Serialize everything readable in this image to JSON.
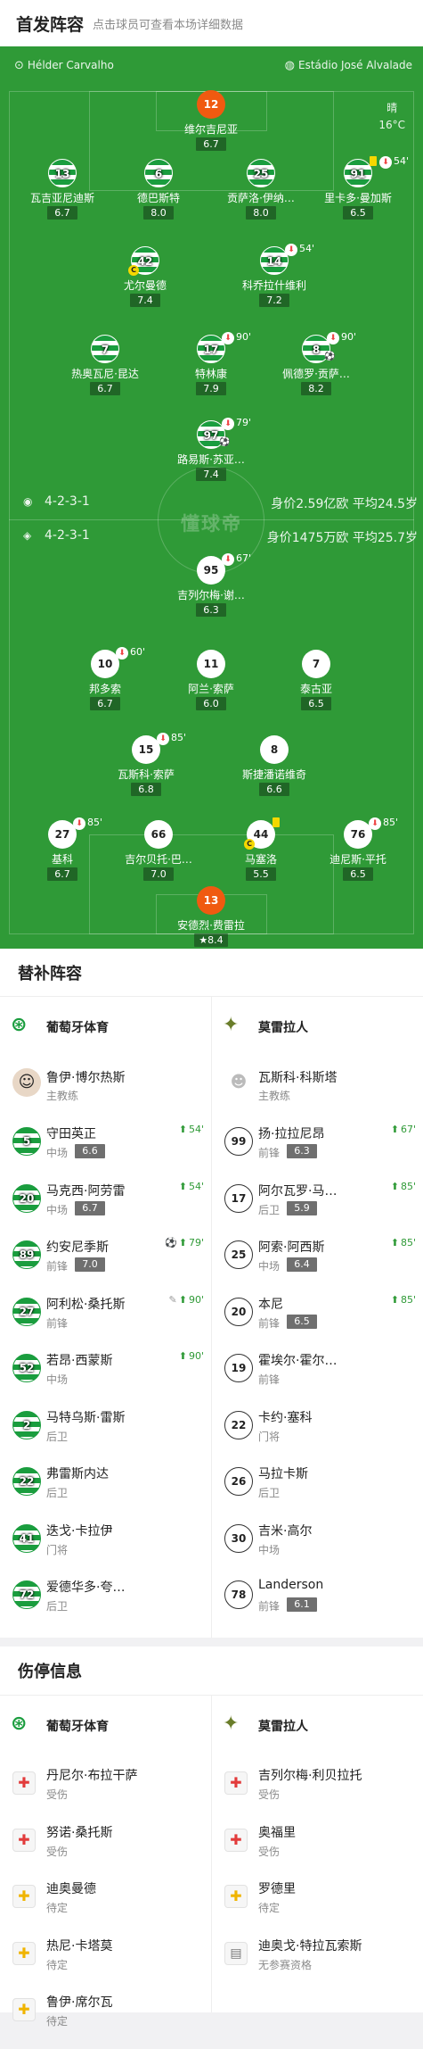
{
  "header": {
    "title": "首发阵容",
    "subtitle": "点击球员可查看本场详细数据"
  },
  "pitch": {
    "referee": "Hélder Carvalho",
    "stadium": "Estádio José Alvalade",
    "weather": "晴",
    "temperature": "16°C",
    "watermark": "懂球帝",
    "home_info": {
      "formation": "4-2-3-1",
      "value_label": "身价2.59亿欧",
      "age_label": "平均24.5岁"
    },
    "away_info": {
      "formation": "4-2-3-1",
      "value_label": "身价1475万欧",
      "age_label": "平均25.7岁"
    }
  },
  "lineup_home": [
    {
      "number": "12",
      "name": "维尔吉尼亚",
      "rating": "6.7",
      "gk": true
    },
    {
      "number": "13",
      "name": "瓦吉亚尼迪斯",
      "rating": "6.7"
    },
    {
      "number": "6",
      "name": "德巴斯特",
      "rating": "8.0"
    },
    {
      "number": "25",
      "name": "贡萨洛·伊纳…",
      "rating": "8.0"
    },
    {
      "number": "91",
      "name": "里卡多·曼加斯",
      "rating": "6.5",
      "card": true,
      "sub_out": "54'"
    },
    {
      "number": "42",
      "name": "尤尔曼德",
      "rating": "7.4",
      "captain": "C"
    },
    {
      "number": "14",
      "name": "科乔拉什维利",
      "rating": "7.2",
      "sub_out": "54'"
    },
    {
      "number": "7",
      "name": "热奥瓦尼·昆达",
      "rating": "6.7"
    },
    {
      "number": "17",
      "name": "特林康",
      "rating": "7.9",
      "sub_out": "90'"
    },
    {
      "number": "8",
      "name": "佩德罗·贡萨…",
      "rating": "8.2",
      "sub_out": "90'",
      "goal": true
    },
    {
      "number": "97",
      "name": "路易斯·苏亚…",
      "rating": "7.4",
      "sub_out": "79'",
      "goal": true
    }
  ],
  "lineup_away": [
    {
      "number": "95",
      "name": "吉列尔梅·谢…",
      "rating": "6.3",
      "sub_out": "67'"
    },
    {
      "number": "10",
      "name": "邦多索",
      "rating": "6.7",
      "sub_out": "60'"
    },
    {
      "number": "11",
      "name": "阿兰·索萨",
      "rating": "6.0"
    },
    {
      "number": "7",
      "name": "泰古亚",
      "rating": "6.5"
    },
    {
      "number": "15",
      "name": "瓦斯科·索萨",
      "rating": "6.8",
      "sub_out": "85'"
    },
    {
      "number": "8",
      "name": "斯捷潘诺维奇",
      "rating": "6.6"
    },
    {
      "number": "27",
      "name": "基科",
      "rating": "6.7",
      "sub_out": "85'"
    },
    {
      "number": "66",
      "name": "吉尔贝托·巴…",
      "rating": "7.0"
    },
    {
      "number": "44",
      "name": "马塞洛",
      "rating": "5.5",
      "card": true,
      "captain": "C"
    },
    {
      "number": "76",
      "name": "迪尼斯·平托",
      "rating": "6.5",
      "sub_out": "85'"
    },
    {
      "number": "13",
      "name": "安德烈·费雷拉",
      "rating": "8.4",
      "gk": true,
      "star": true
    }
  ],
  "subs": {
    "title": "替补阵容",
    "home_team": "葡萄牙体育",
    "away_team": "莫雷拉人",
    "home_coach": {
      "name": "鲁伊·博尔热斯",
      "role": "主教练"
    },
    "away_coach": {
      "name": "瓦斯科·科斯塔",
      "role": "主教练"
    },
    "home": [
      {
        "number": "5",
        "name": "守田英正",
        "pos": "中场",
        "rating": "6.6",
        "event": "54'"
      },
      {
        "number": "20",
        "name": "马克西·阿劳雷",
        "pos": "中场",
        "rating": "6.7",
        "event": "54'"
      },
      {
        "number": "89",
        "name": "约安尼季斯",
        "pos": "前锋",
        "rating": "7.0",
        "event": "79'",
        "goal": true
      },
      {
        "number": "27",
        "name": "阿利松·桑托斯",
        "pos": "前锋",
        "rating": "",
        "event": "90'",
        "boot": true
      },
      {
        "number": "52",
        "name": "若昂·西蒙斯",
        "pos": "中场",
        "rating": "",
        "event": "90'"
      },
      {
        "number": "2",
        "name": "马特乌斯·雷斯",
        "pos": "后卫",
        "rating": "",
        "event": ""
      },
      {
        "number": "22",
        "name": "弗雷斯内达",
        "pos": "后卫",
        "rating": "",
        "event": ""
      },
      {
        "number": "41",
        "name": "迭戈·卡拉伊",
        "pos": "门将",
        "rating": "",
        "event": ""
      },
      {
        "number": "72",
        "name": "爱德华多·夸…",
        "pos": "后卫",
        "rating": "",
        "event": ""
      }
    ],
    "away": [
      {
        "number": "99",
        "name": "扬·拉拉尼昂",
        "pos": "前锋",
        "rating": "6.3",
        "event": "67'"
      },
      {
        "number": "17",
        "name": "阿尔瓦罗·马…",
        "pos": "后卫",
        "rating": "5.9",
        "event": "85'"
      },
      {
        "number": "25",
        "name": "阿索·阿西斯",
        "pos": "中场",
        "rating": "6.4",
        "event": "85'"
      },
      {
        "number": "20",
        "name": "本尼",
        "pos": "前锋",
        "rating": "6.5",
        "event": "85'"
      },
      {
        "number": "19",
        "name": "霍埃尔·霍尔…",
        "pos": "前锋",
        "rating": "",
        "event": ""
      },
      {
        "number": "22",
        "name": "卡约·塞科",
        "pos": "门将",
        "rating": "",
        "event": ""
      },
      {
        "number": "26",
        "name": "马拉卡斯",
        "pos": "后卫",
        "rating": "",
        "event": ""
      },
      {
        "number": "30",
        "name": "吉米·高尔",
        "pos": "中场",
        "rating": "",
        "event": ""
      },
      {
        "number": "78",
        "name": "Landerson",
        "pos": "前锋",
        "rating": "6.1",
        "event": ""
      }
    ]
  },
  "injuries": {
    "title": "伤停信息",
    "home_team": "葡萄牙体育",
    "away_team": "莫雷拉人",
    "home": [
      {
        "name": "丹尼尔·布拉干萨",
        "status": "受伤",
        "type": "red"
      },
      {
        "name": "努诺·桑托斯",
        "status": "受伤",
        "type": "red"
      },
      {
        "name": "迪奥曼德",
        "status": "待定",
        "type": "yel"
      },
      {
        "name": "热尼·卡塔莫",
        "status": "待定",
        "type": "yel"
      },
      {
        "name": "鲁伊·席尔瓦",
        "status": "待定",
        "type": "yel"
      }
    ],
    "away": [
      {
        "name": "吉列尔梅·利贝拉托",
        "status": "受伤",
        "type": "red"
      },
      {
        "name": "奥福里",
        "status": "受伤",
        "type": "red"
      },
      {
        "name": "罗德里",
        "status": "待定",
        "type": "yel"
      },
      {
        "name": "迪奥戈·特拉瓦索斯",
        "status": "无参赛资格",
        "type": "doc"
      }
    ]
  }
}
